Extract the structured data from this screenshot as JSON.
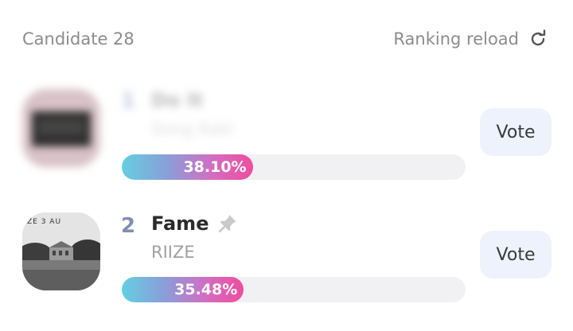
{
  "header": {
    "candidate_label": "Candidate 28",
    "reload_label": "Ranking reload",
    "reload_icon": "refresh-icon"
  },
  "entries": [
    {
      "rank": "1",
      "title": "Do It",
      "artist": "Song Kaki",
      "percent": "38.10%",
      "fraction": 0.381,
      "vote_label": "Vote",
      "blurred": true
    },
    {
      "rank": "2",
      "title": "Fame",
      "artist": "RIIZE",
      "percent": "35.48%",
      "fraction": 0.3548,
      "vote_label": "Vote",
      "blurred": false
    }
  ],
  "colors": {
    "gradient_start": "#63cfe0",
    "gradient_end": "#ee4d9e",
    "vote_bg": "#eef2fc",
    "rank_color": "#8090b4"
  }
}
